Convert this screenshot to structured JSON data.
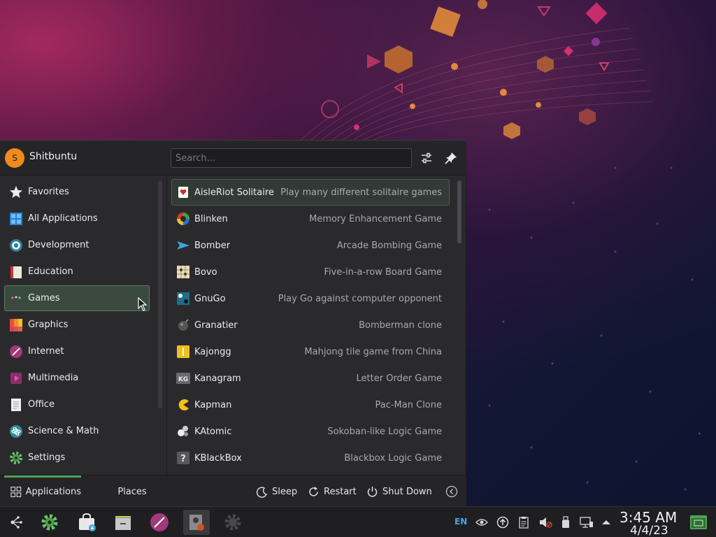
{
  "user": {
    "initial": "S",
    "name": "Shitbuntu"
  },
  "search": {
    "placeholder": "Search...",
    "value": ""
  },
  "categories": [
    {
      "label": "Favorites",
      "icon": "star-icon"
    },
    {
      "label": "All Applications",
      "icon": "grid-icon"
    },
    {
      "label": "Development",
      "icon": "development-icon"
    },
    {
      "label": "Education",
      "icon": "education-icon"
    },
    {
      "label": "Games",
      "icon": "games-icon",
      "active": true
    },
    {
      "label": "Graphics",
      "icon": "graphics-icon"
    },
    {
      "label": "Internet",
      "icon": "internet-icon"
    },
    {
      "label": "Multimedia",
      "icon": "multimedia-icon"
    },
    {
      "label": "Office",
      "icon": "office-icon"
    },
    {
      "label": "Science & Math",
      "icon": "science-icon"
    },
    {
      "label": "Settings",
      "icon": "settings-icon"
    }
  ],
  "apps": [
    {
      "name": "AisleRiot Solitaire",
      "desc": "Play many different solitaire games",
      "icon": "cards-icon"
    },
    {
      "name": "Blinken",
      "desc": "Memory Enhancement Game",
      "icon": "blinken-icon"
    },
    {
      "name": "Bomber",
      "desc": "Arcade Bombing Game",
      "icon": "plane-icon"
    },
    {
      "name": "Bovo",
      "desc": "Five-in-a-row Board Game",
      "icon": "bovo-icon"
    },
    {
      "name": "GnuGo",
      "desc": "Play Go against computer opponent",
      "icon": "go-icon"
    },
    {
      "name": "Granatier",
      "desc": "Bomberman clone",
      "icon": "bomb-icon"
    },
    {
      "name": "Kajongg",
      "desc": "Mahjong tile game from China",
      "icon": "mahjong-icon"
    },
    {
      "name": "Kanagram",
      "desc": "Letter Order Game",
      "icon": "kanagram-icon"
    },
    {
      "name": "Kapman",
      "desc": "Pac-Man Clone",
      "icon": "pacman-icon"
    },
    {
      "name": "KAtomic",
      "desc": "Sokoban-like Logic Game",
      "icon": "atom-icon"
    },
    {
      "name": "KBlackBox",
      "desc": "Blackbox Logic Game",
      "icon": "question-icon"
    }
  ],
  "footer": {
    "tab_applications": "Applications",
    "tab_places": "Places",
    "sleep": "Sleep",
    "restart": "Restart",
    "shutdown": "Shut Down"
  },
  "taskbar": {
    "language": "EN",
    "time": "3:45 AM",
    "date": "4/4/23"
  },
  "colors": {
    "accent_green": "#4fa356",
    "avatar_orange": "#ef8a1c",
    "lang_blue": "#4aa3e8"
  }
}
